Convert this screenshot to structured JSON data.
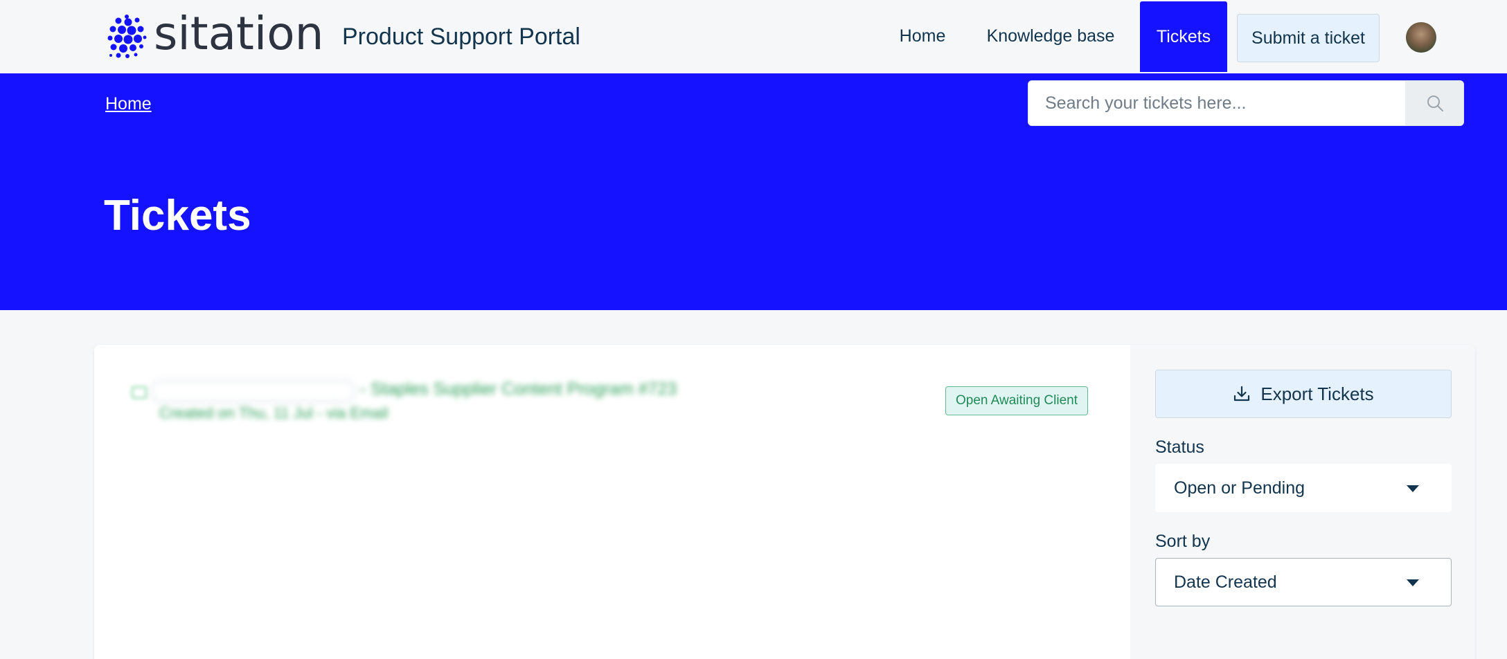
{
  "header": {
    "brand": "sitation",
    "portal_name": "Product Support Portal",
    "nav": {
      "home": "Home",
      "knowledge_base": "Knowledge base",
      "tickets": "Tickets",
      "submit_ticket": "Submit a ticket"
    }
  },
  "hero": {
    "breadcrumb": "Home",
    "search_placeholder": "Search your tickets here...",
    "title": "Tickets"
  },
  "tickets": [
    {
      "subject": "- Staples Supplier Content Program #723",
      "meta": "Created on Thu, 11 Jul - via Email",
      "status": "Open Awaiting Client"
    }
  ],
  "sidebar": {
    "export_label": "Export Tickets",
    "status_label": "Status",
    "status_value": "Open or Pending",
    "sort_label": "Sort by",
    "sort_value": "Date Created"
  },
  "colors": {
    "brand_blue": "#1412ff",
    "status_green": "#1f8a57",
    "text_dark": "#12344d"
  },
  "icons": {
    "search": "search-icon",
    "export": "download-icon",
    "dropdown": "caret-down-icon"
  }
}
